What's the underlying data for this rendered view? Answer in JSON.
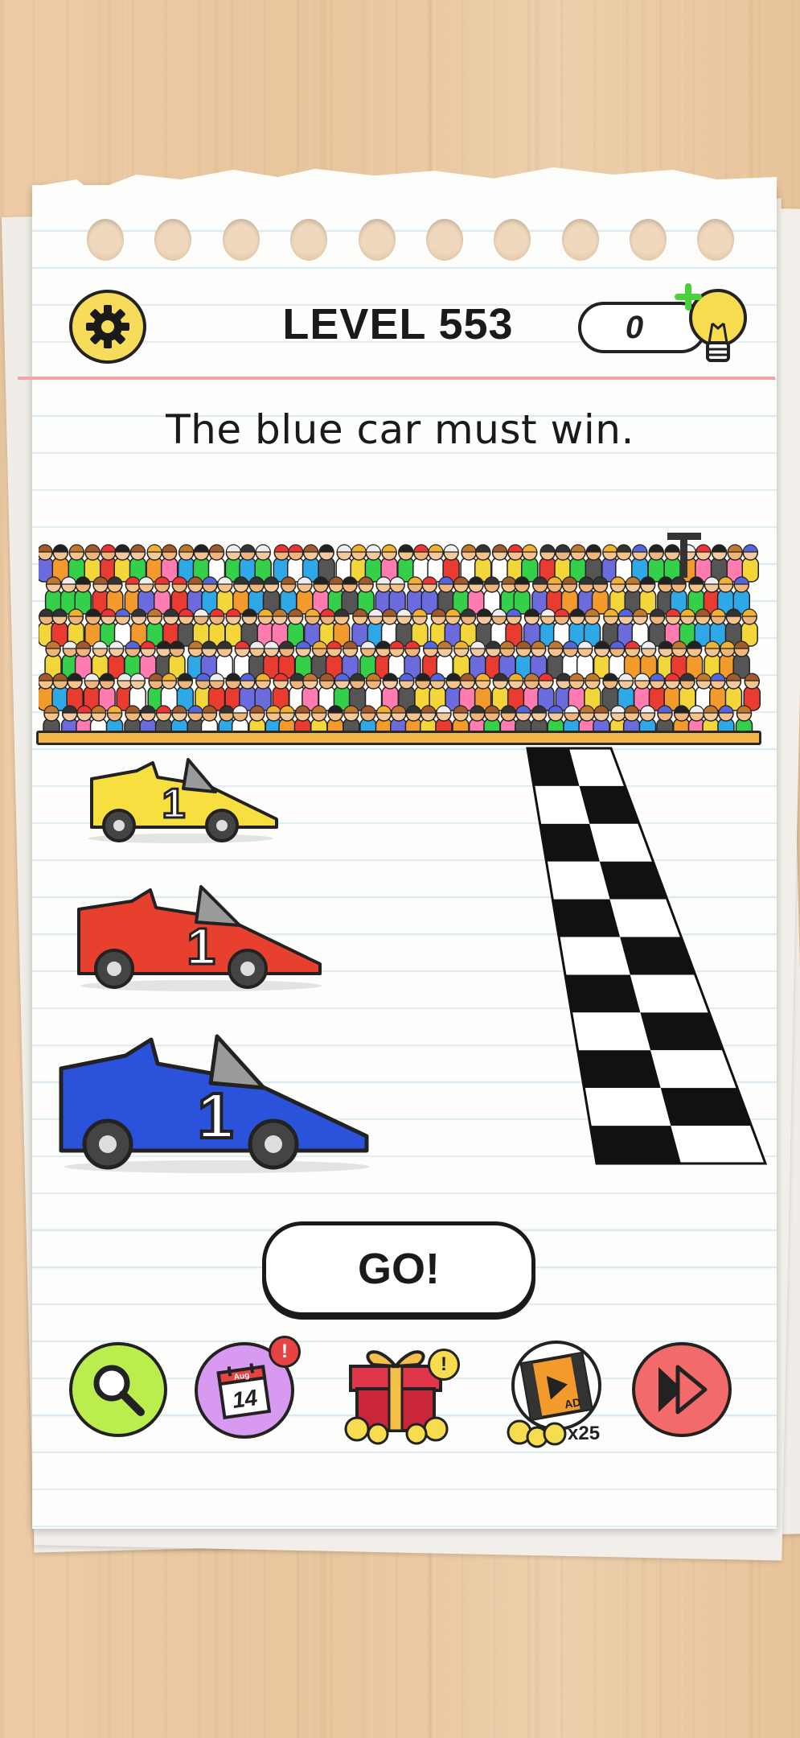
{
  "header": {
    "level_label": "LEVEL 553",
    "hint_count": "0"
  },
  "question": "The blue car must win.",
  "cars": [
    {
      "color": "yellow",
      "number": "1",
      "fill": "#f6df3e"
    },
    {
      "color": "red",
      "number": "1",
      "fill": "#e8402f"
    },
    {
      "color": "blue",
      "number": "1",
      "fill": "#2a52db"
    }
  ],
  "go_button": {
    "label": "GO!"
  },
  "toolbar": {
    "search_icon": "magnifier-icon",
    "calendar_date": "14",
    "calendar_month": "Aug",
    "calendar_badge": "!",
    "gift_badge": "!",
    "ad_label": "AD",
    "ad_multiplier": "x25",
    "skip_icon": "fast-forward-icon"
  },
  "colors": {
    "accent_yellow": "#f6dc5a",
    "search_green": "#b9ee4e",
    "calendar_purple": "#d89af0",
    "skip_red": "#f26a6a",
    "badge_red": "#e74343"
  }
}
